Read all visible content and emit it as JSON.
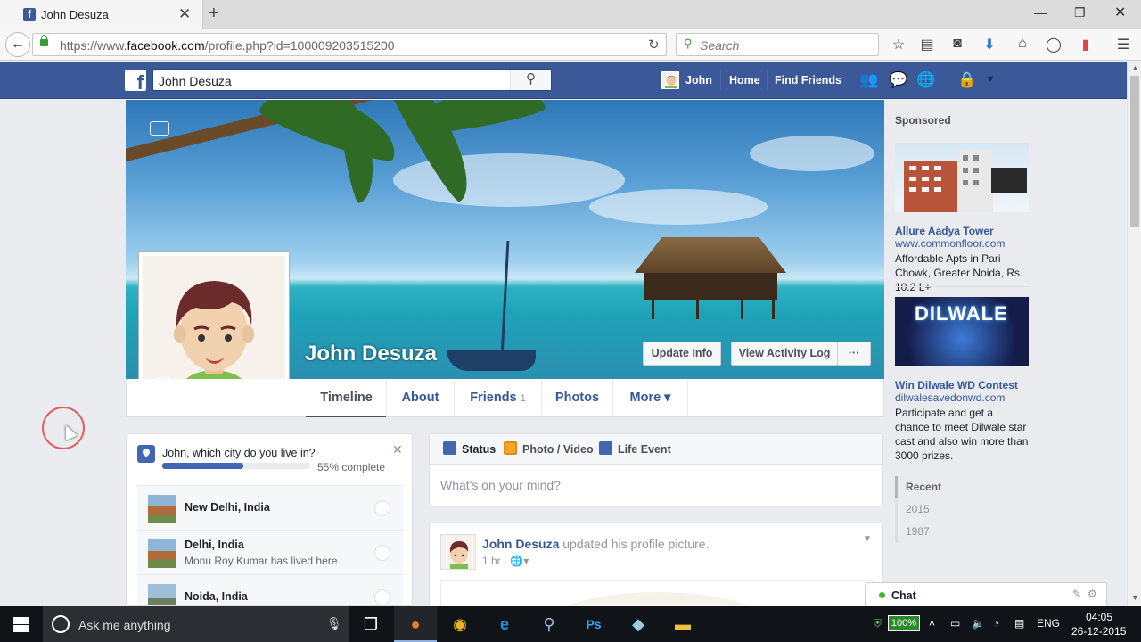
{
  "browser": {
    "tab_title": "John Desuza",
    "url_prefix": "https://www.",
    "url_domain": "facebook.com",
    "url_path": "/profile.php?id=100009203515200",
    "search_placeholder": "Search"
  },
  "fbbar": {
    "search_value": "John Desuza",
    "user_name": "John",
    "home": "Home",
    "find_friends": "Find Friends"
  },
  "profile": {
    "name": "John Desuza",
    "update_info": "Update Info",
    "view_activity_log": "View Activity Log",
    "more_dots": "···",
    "tabs": [
      {
        "label": "Timeline"
      },
      {
        "label": "About"
      },
      {
        "label": "Friends",
        "count": "1"
      },
      {
        "label": "Photos"
      },
      {
        "label": "More ▾"
      }
    ]
  },
  "city_card": {
    "question": "John, which city do you live in?",
    "progress_percent": 55,
    "progress_label": "55% complete",
    "cities": [
      {
        "name": "New Delhi, India",
        "sub": ""
      },
      {
        "name": "Delhi, India",
        "sub": "Monu Roy Kumar has lived here"
      },
      {
        "name": "Noida, India",
        "sub": ""
      }
    ]
  },
  "composer": {
    "status": "Status",
    "photo_video": "Photo / Video",
    "life_event": "Life Event",
    "placeholder": "What's on your mind?"
  },
  "post": {
    "author": "John Desuza",
    "action": " updated his profile picture.",
    "time": "1 hr ·"
  },
  "sidebar": {
    "sponsored": "Sponsored",
    "ads": [
      {
        "title": "Allure Aadya Tower",
        "url": "www.commonfloor.com",
        "desc": "Affordable Apts in Pari Chowk, Greater Noida, Rs. 10.2 L+"
      },
      {
        "title": "Win Dilwale WD Contest",
        "url": "dilwalesavedonwd.com",
        "desc": "Participate and get a chance to meet Dilwale star cast and also win more than 3000 prizes.",
        "image_text": "DILWALE"
      }
    ],
    "years": [
      "Recent",
      "2015",
      "1987"
    ]
  },
  "chat": {
    "label": "Chat"
  },
  "taskbar": {
    "cortana_placeholder": "Ask me anything",
    "battery": "100%",
    "lang": "ENG",
    "time": "04:05",
    "date": "26-12-2015"
  }
}
